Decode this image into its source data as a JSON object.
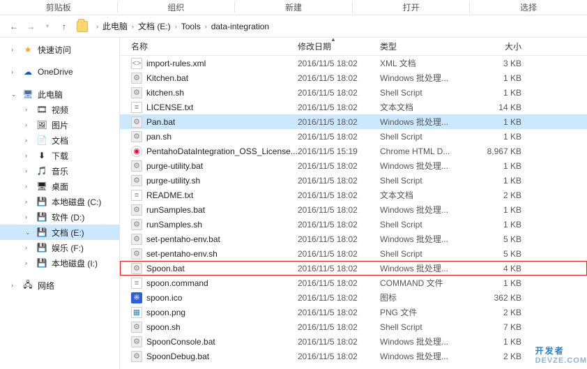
{
  "ribbon": {
    "groups": [
      "剪贴板",
      "组织",
      "新建",
      "打开",
      "选择"
    ]
  },
  "breadcrumb": {
    "root": "此电脑",
    "items": [
      "文档 (E:)",
      "Tools",
      "data-integration"
    ]
  },
  "sidebar": {
    "quick": {
      "label": "快速访问"
    },
    "onedrive": {
      "label": "OneDrive"
    },
    "pc": {
      "label": "此电脑"
    },
    "pc_items": [
      {
        "label": "视频",
        "icon": "video"
      },
      {
        "label": "图片",
        "icon": "pictures"
      },
      {
        "label": "文档",
        "icon": "documents"
      },
      {
        "label": "下载",
        "icon": "downloads"
      },
      {
        "label": "音乐",
        "icon": "music"
      },
      {
        "label": "桌面",
        "icon": "desktop"
      },
      {
        "label": "本地磁盘 (C:)",
        "icon": "drive"
      },
      {
        "label": "软件 (D:)",
        "icon": "drive"
      },
      {
        "label": "文档 (E:)",
        "icon": "drive",
        "selected": true
      },
      {
        "label": "娱乐 (F:)",
        "icon": "drive"
      },
      {
        "label": "本地磁盘 (I:)",
        "icon": "drive"
      }
    ],
    "network": {
      "label": "网络"
    }
  },
  "columns": {
    "name": "名称",
    "date": "修改日期",
    "type": "类型",
    "size": "大小"
  },
  "files": [
    {
      "name": "import-rules.xml",
      "date": "2016/11/5 18:02",
      "type": "XML 文档",
      "size": "3 KB",
      "icon": "xml"
    },
    {
      "name": "Kitchen.bat",
      "date": "2016/11/5 18:02",
      "type": "Windows 批处理...",
      "size": "1 KB",
      "icon": "bat"
    },
    {
      "name": "kitchen.sh",
      "date": "2016/11/5 18:02",
      "type": "Shell Script",
      "size": "1 KB",
      "icon": "bat"
    },
    {
      "name": "LICENSE.txt",
      "date": "2016/11/5 18:02",
      "type": "文本文档",
      "size": "14 KB",
      "icon": "txt"
    },
    {
      "name": "Pan.bat",
      "date": "2016/11/5 18:02",
      "type": "Windows 批处理...",
      "size": "1 KB",
      "icon": "bat",
      "selected": true
    },
    {
      "name": "pan.sh",
      "date": "2016/11/5 18:02",
      "type": "Shell Script",
      "size": "1 KB",
      "icon": "bat"
    },
    {
      "name": "PentahoDataIntegration_OSS_License...",
      "date": "2016/11/5 15:19",
      "type": "Chrome HTML D...",
      "size": "8,967 KB",
      "icon": "html"
    },
    {
      "name": "purge-utility.bat",
      "date": "2016/11/5 18:02",
      "type": "Windows 批处理...",
      "size": "1 KB",
      "icon": "bat"
    },
    {
      "name": "purge-utility.sh",
      "date": "2016/11/5 18:02",
      "type": "Shell Script",
      "size": "1 KB",
      "icon": "bat"
    },
    {
      "name": "README.txt",
      "date": "2016/11/5 18:02",
      "type": "文本文档",
      "size": "2 KB",
      "icon": "txt"
    },
    {
      "name": "runSamples.bat",
      "date": "2016/11/5 18:02",
      "type": "Windows 批处理...",
      "size": "1 KB",
      "icon": "bat"
    },
    {
      "name": "runSamples.sh",
      "date": "2016/11/5 18:02",
      "type": "Shell Script",
      "size": "1 KB",
      "icon": "bat"
    },
    {
      "name": "set-pentaho-env.bat",
      "date": "2016/11/5 18:02",
      "type": "Windows 批处理...",
      "size": "5 KB",
      "icon": "bat"
    },
    {
      "name": "set-pentaho-env.sh",
      "date": "2016/11/5 18:02",
      "type": "Shell Script",
      "size": "5 KB",
      "icon": "bat"
    },
    {
      "name": "Spoon.bat",
      "date": "2016/11/5 18:02",
      "type": "Windows 批处理...",
      "size": "4 KB",
      "icon": "bat",
      "highlighted": true
    },
    {
      "name": "spoon.command",
      "date": "2016/11/5 18:02",
      "type": "COMMAND 文件",
      "size": "1 KB",
      "icon": "txt"
    },
    {
      "name": "spoon.ico",
      "date": "2016/11/5 18:02",
      "type": "图标",
      "size": "362 KB",
      "icon": "ico"
    },
    {
      "name": "spoon.png",
      "date": "2016/11/5 18:02",
      "type": "PNG 文件",
      "size": "2 KB",
      "icon": "png"
    },
    {
      "name": "spoon.sh",
      "date": "2016/11/5 18:02",
      "type": "Shell Script",
      "size": "7 KB",
      "icon": "bat"
    },
    {
      "name": "SpoonConsole.bat",
      "date": "2016/11/5 18:02",
      "type": "Windows 批处理...",
      "size": "1 KB",
      "icon": "bat"
    },
    {
      "name": "SpoonDebug.bat",
      "date": "2016/11/5 18:02",
      "type": "Windows 批处理...",
      "size": "2 KB",
      "icon": "bat"
    }
  ],
  "watermark": {
    "main": "开发者",
    "sub": "DEVZE.COM"
  }
}
